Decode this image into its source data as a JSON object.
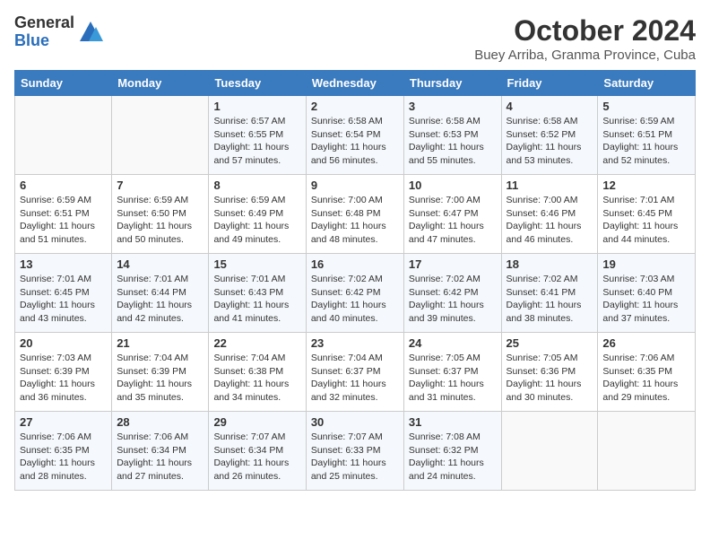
{
  "header": {
    "logo_general": "General",
    "logo_blue": "Blue",
    "month_title": "October 2024",
    "location": "Buey Arriba, Granma Province, Cuba"
  },
  "weekdays": [
    "Sunday",
    "Monday",
    "Tuesday",
    "Wednesday",
    "Thursday",
    "Friday",
    "Saturday"
  ],
  "weeks": [
    [
      {
        "day": "",
        "sunrise": "",
        "sunset": "",
        "daylight": ""
      },
      {
        "day": "",
        "sunrise": "",
        "sunset": "",
        "daylight": ""
      },
      {
        "day": "1",
        "sunrise": "Sunrise: 6:57 AM",
        "sunset": "Sunset: 6:55 PM",
        "daylight": "Daylight: 11 hours and 57 minutes."
      },
      {
        "day": "2",
        "sunrise": "Sunrise: 6:58 AM",
        "sunset": "Sunset: 6:54 PM",
        "daylight": "Daylight: 11 hours and 56 minutes."
      },
      {
        "day": "3",
        "sunrise": "Sunrise: 6:58 AM",
        "sunset": "Sunset: 6:53 PM",
        "daylight": "Daylight: 11 hours and 55 minutes."
      },
      {
        "day": "4",
        "sunrise": "Sunrise: 6:58 AM",
        "sunset": "Sunset: 6:52 PM",
        "daylight": "Daylight: 11 hours and 53 minutes."
      },
      {
        "day": "5",
        "sunrise": "Sunrise: 6:59 AM",
        "sunset": "Sunset: 6:51 PM",
        "daylight": "Daylight: 11 hours and 52 minutes."
      }
    ],
    [
      {
        "day": "6",
        "sunrise": "Sunrise: 6:59 AM",
        "sunset": "Sunset: 6:51 PM",
        "daylight": "Daylight: 11 hours and 51 minutes."
      },
      {
        "day": "7",
        "sunrise": "Sunrise: 6:59 AM",
        "sunset": "Sunset: 6:50 PM",
        "daylight": "Daylight: 11 hours and 50 minutes."
      },
      {
        "day": "8",
        "sunrise": "Sunrise: 6:59 AM",
        "sunset": "Sunset: 6:49 PM",
        "daylight": "Daylight: 11 hours and 49 minutes."
      },
      {
        "day": "9",
        "sunrise": "Sunrise: 7:00 AM",
        "sunset": "Sunset: 6:48 PM",
        "daylight": "Daylight: 11 hours and 48 minutes."
      },
      {
        "day": "10",
        "sunrise": "Sunrise: 7:00 AM",
        "sunset": "Sunset: 6:47 PM",
        "daylight": "Daylight: 11 hours and 47 minutes."
      },
      {
        "day": "11",
        "sunrise": "Sunrise: 7:00 AM",
        "sunset": "Sunset: 6:46 PM",
        "daylight": "Daylight: 11 hours and 46 minutes."
      },
      {
        "day": "12",
        "sunrise": "Sunrise: 7:01 AM",
        "sunset": "Sunset: 6:45 PM",
        "daylight": "Daylight: 11 hours and 44 minutes."
      }
    ],
    [
      {
        "day": "13",
        "sunrise": "Sunrise: 7:01 AM",
        "sunset": "Sunset: 6:45 PM",
        "daylight": "Daylight: 11 hours and 43 minutes."
      },
      {
        "day": "14",
        "sunrise": "Sunrise: 7:01 AM",
        "sunset": "Sunset: 6:44 PM",
        "daylight": "Daylight: 11 hours and 42 minutes."
      },
      {
        "day": "15",
        "sunrise": "Sunrise: 7:01 AM",
        "sunset": "Sunset: 6:43 PM",
        "daylight": "Daylight: 11 hours and 41 minutes."
      },
      {
        "day": "16",
        "sunrise": "Sunrise: 7:02 AM",
        "sunset": "Sunset: 6:42 PM",
        "daylight": "Daylight: 11 hours and 40 minutes."
      },
      {
        "day": "17",
        "sunrise": "Sunrise: 7:02 AM",
        "sunset": "Sunset: 6:42 PM",
        "daylight": "Daylight: 11 hours and 39 minutes."
      },
      {
        "day": "18",
        "sunrise": "Sunrise: 7:02 AM",
        "sunset": "Sunset: 6:41 PM",
        "daylight": "Daylight: 11 hours and 38 minutes."
      },
      {
        "day": "19",
        "sunrise": "Sunrise: 7:03 AM",
        "sunset": "Sunset: 6:40 PM",
        "daylight": "Daylight: 11 hours and 37 minutes."
      }
    ],
    [
      {
        "day": "20",
        "sunrise": "Sunrise: 7:03 AM",
        "sunset": "Sunset: 6:39 PM",
        "daylight": "Daylight: 11 hours and 36 minutes."
      },
      {
        "day": "21",
        "sunrise": "Sunrise: 7:04 AM",
        "sunset": "Sunset: 6:39 PM",
        "daylight": "Daylight: 11 hours and 35 minutes."
      },
      {
        "day": "22",
        "sunrise": "Sunrise: 7:04 AM",
        "sunset": "Sunset: 6:38 PM",
        "daylight": "Daylight: 11 hours and 34 minutes."
      },
      {
        "day": "23",
        "sunrise": "Sunrise: 7:04 AM",
        "sunset": "Sunset: 6:37 PM",
        "daylight": "Daylight: 11 hours and 32 minutes."
      },
      {
        "day": "24",
        "sunrise": "Sunrise: 7:05 AM",
        "sunset": "Sunset: 6:37 PM",
        "daylight": "Daylight: 11 hours and 31 minutes."
      },
      {
        "day": "25",
        "sunrise": "Sunrise: 7:05 AM",
        "sunset": "Sunset: 6:36 PM",
        "daylight": "Daylight: 11 hours and 30 minutes."
      },
      {
        "day": "26",
        "sunrise": "Sunrise: 7:06 AM",
        "sunset": "Sunset: 6:35 PM",
        "daylight": "Daylight: 11 hours and 29 minutes."
      }
    ],
    [
      {
        "day": "27",
        "sunrise": "Sunrise: 7:06 AM",
        "sunset": "Sunset: 6:35 PM",
        "daylight": "Daylight: 11 hours and 28 minutes."
      },
      {
        "day": "28",
        "sunrise": "Sunrise: 7:06 AM",
        "sunset": "Sunset: 6:34 PM",
        "daylight": "Daylight: 11 hours and 27 minutes."
      },
      {
        "day": "29",
        "sunrise": "Sunrise: 7:07 AM",
        "sunset": "Sunset: 6:34 PM",
        "daylight": "Daylight: 11 hours and 26 minutes."
      },
      {
        "day": "30",
        "sunrise": "Sunrise: 7:07 AM",
        "sunset": "Sunset: 6:33 PM",
        "daylight": "Daylight: 11 hours and 25 minutes."
      },
      {
        "day": "31",
        "sunrise": "Sunrise: 7:08 AM",
        "sunset": "Sunset: 6:32 PM",
        "daylight": "Daylight: 11 hours and 24 minutes."
      },
      {
        "day": "",
        "sunrise": "",
        "sunset": "",
        "daylight": ""
      },
      {
        "day": "",
        "sunrise": "",
        "sunset": "",
        "daylight": ""
      }
    ]
  ]
}
